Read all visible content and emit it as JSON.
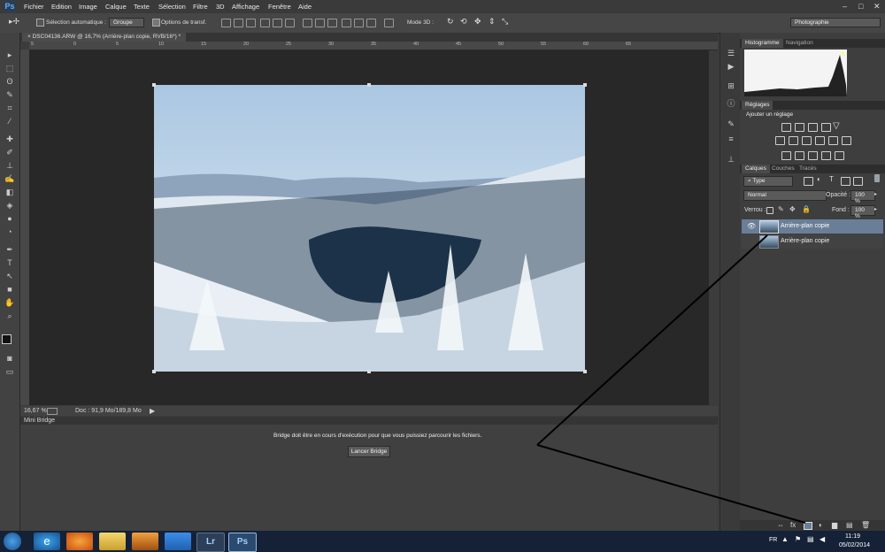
{
  "app": {
    "logo": "Ps"
  },
  "menu": [
    "Fichier",
    "Edition",
    "Image",
    "Calque",
    "Texte",
    "Sélection",
    "Filtre",
    "3D",
    "Affichage",
    "Fenêtre",
    "Aide"
  ],
  "window_controls": {
    "minimize": "–",
    "maximize": "□",
    "close": "✕"
  },
  "options": {
    "auto_select_label": "Sélection automatique :",
    "group_value": "Groupe",
    "transform_label": "Options de transf.",
    "mode_3d_label": "Mode 3D :",
    "workspace": "Photographie"
  },
  "document": {
    "tab_title": "DSC04136.ARW @ 16,7% (Arrière-plan copie, RVB/16*) *",
    "zoom": "16,67 %",
    "doc_info": "Doc : 91,9 Mo/189,8 Mo"
  },
  "ruler_h_ticks": [
    "5",
    "0",
    "5",
    "10",
    "15",
    "20",
    "25",
    "30",
    "35",
    "40",
    "45",
    "50",
    "55",
    "60",
    "65"
  ],
  "mini_bridge": {
    "title": "Mini Bridge",
    "message": "Bridge doit être en cours d'exécution pour que vous puissiez parcourir les fichiers.",
    "launch_button": "Lancer Bridge"
  },
  "panels": {
    "histogram_tabs": [
      "Histogramme",
      "Navigation"
    ],
    "adjust_tab": "Réglages",
    "adjust_title": "Ajouter un réglage",
    "layers_tabs": [
      "Calques",
      "Couches",
      "Tracés"
    ],
    "filter_type": "Type",
    "blend_mode": "Normal",
    "opacity_label": "Opacité :",
    "opacity_value": "100 %",
    "lock_label": "Verrou :",
    "fill_label": "Fond :",
    "fill_value": "100 %",
    "layers": [
      {
        "name": "Arrière-plan copie",
        "visible": true,
        "selected": true
      },
      {
        "name": "Arrière-plan copie",
        "visible": false,
        "selected": false
      }
    ]
  },
  "taskbar": {
    "lang": "FR",
    "time": "11:19",
    "date": "05/02/2014",
    "apps": [
      "start",
      "ie",
      "firefox",
      "explorer",
      "media",
      "vlc",
      "lightroom",
      "photoshop"
    ],
    "lr_label": "Lr",
    "ps_label": "Ps"
  },
  "colors": {
    "accent_selected_layer": "#6a7e98",
    "app_bg": "#3c3c3c",
    "taskbar": "#142136"
  }
}
